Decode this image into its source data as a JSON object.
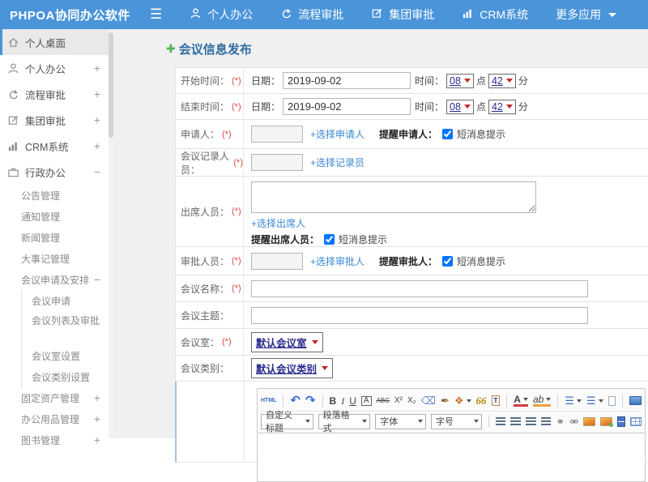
{
  "topbar": {
    "brand": "PHPOA协同办公软件",
    "menu": [
      {
        "label": "个人办公"
      },
      {
        "label": "流程审批"
      },
      {
        "label": "集团审批"
      },
      {
        "label": "CRM系统"
      },
      {
        "label": "更多应用"
      }
    ]
  },
  "sidebar": {
    "items": [
      {
        "label": "个人桌面",
        "toggle": ""
      },
      {
        "label": "个人办公",
        "toggle": "+"
      },
      {
        "label": "流程审批",
        "toggle": "+"
      },
      {
        "label": "集团审批",
        "toggle": "+"
      },
      {
        "label": "CRM系统",
        "toggle": "+"
      },
      {
        "label": "行政办公",
        "toggle": "−"
      }
    ],
    "admin_children": [
      {
        "label": "公告管理",
        "toggle": ""
      },
      {
        "label": "通知管理",
        "toggle": ""
      },
      {
        "label": "新闻管理",
        "toggle": ""
      },
      {
        "label": "大事记管理",
        "toggle": ""
      },
      {
        "label": "会议申请及安排",
        "toggle": "−"
      }
    ],
    "meeting_children": [
      {
        "label": "会议申请"
      },
      {
        "label": "会议列表及审批"
      },
      {
        "label": "会议室设置"
      },
      {
        "label": "会议类别设置"
      }
    ],
    "bottom_items": [
      {
        "label": "固定资产管理",
        "toggle": "+"
      },
      {
        "label": "办公用品管理",
        "toggle": "+"
      },
      {
        "label": "图书管理",
        "toggle": "+"
      }
    ]
  },
  "page": {
    "title": "会议信息发布"
  },
  "form": {
    "required": "(*)",
    "start_label": "开始时间：",
    "end_label": "结束时间：",
    "date_label": "日期：",
    "time_label": "时间：",
    "hour_unit": "点",
    "minute_unit": "分",
    "start_date": "2019-09-02",
    "start_hour": "08",
    "start_minute": "42",
    "end_date": "2019-09-02",
    "end_hour": "08",
    "end_minute": "42",
    "applicant_label": "申请人：",
    "applicant_link": "+选择申请人",
    "applicant_remind": "提醒申请人：",
    "recorder_label": "会议记录人员：",
    "recorder_link": "+选择记录员",
    "attendees_label": "出席人员：",
    "attendees_link": "+选择出席人",
    "attendees_remind": "提醒出席人员：",
    "approver_label": "审批人员：",
    "approver_link": "+选择审批人",
    "approver_remind": "提醒审批人：",
    "sms_label": "短消息提示",
    "name_label": "会议名称：",
    "subject_label": "会议主题：",
    "room_label": "会议室：",
    "room_value": "默认会议室",
    "category_label": "会议类别：",
    "category_value": "默认会议类别"
  },
  "editor": {
    "glyphs": {
      "html": "HTML",
      "undo": "↶",
      "redo": "↷",
      "bold": "B",
      "italic": "I",
      "underline": "U",
      "box_a": "A",
      "strike": "ABC",
      "sup": "X²",
      "sub": "X₂",
      "eraser": "⌫",
      "brush": "✒",
      "palette": "❖",
      "quote": "66",
      "paste_t": "T",
      "font_color": "A",
      "highlight": "ab",
      "ordered_list": "☰",
      "bullet_list": "☰",
      "link": "⚭",
      "unlink": "⚮"
    },
    "selects": [
      {
        "label": "自定义标题"
      },
      {
        "label": "段落格式"
      },
      {
        "label": "字体"
      },
      {
        "label": "字号"
      }
    ]
  },
  "colors": {
    "topbar_bg": "#4a94da",
    "accent_blue": "#2e6da4",
    "link_blue": "#3a87d6",
    "required_red": "#e14646"
  }
}
